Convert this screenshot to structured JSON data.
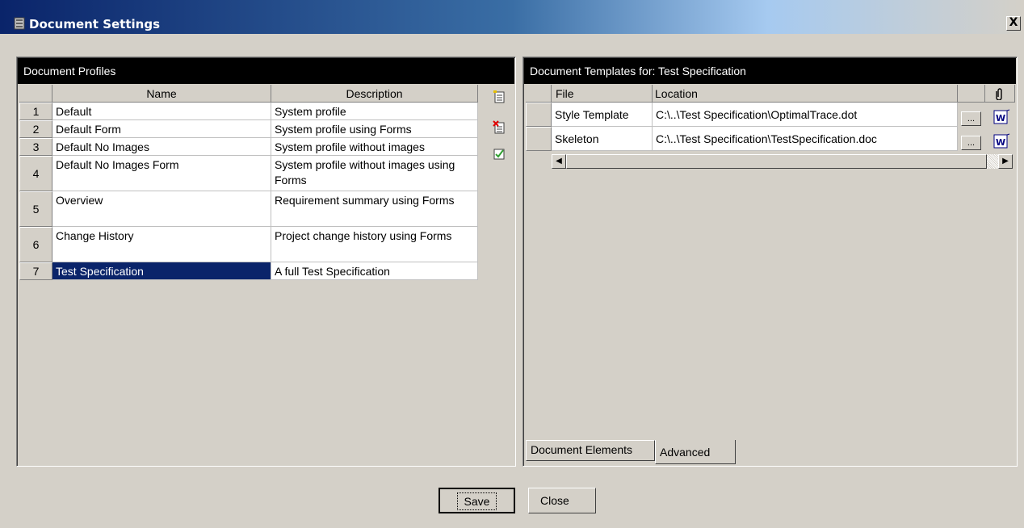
{
  "window": {
    "title": "Document Settings",
    "close_label": "X"
  },
  "profiles": {
    "header": "Document Profiles",
    "columns": [
      "Name",
      "Description"
    ],
    "rows": [
      {
        "num": "1",
        "name": "Default",
        "description": "System profile"
      },
      {
        "num": "2",
        "name": "Default Form",
        "description": "System profile using Forms"
      },
      {
        "num": "3",
        "name": "Default No Images",
        "description": "System profile without images"
      },
      {
        "num": "4",
        "name": "Default No Images Form",
        "description": "System profile without images using Forms"
      },
      {
        "num": "5",
        "name": "Overview",
        "description": "Requirement summary using Forms"
      },
      {
        "num": "6",
        "name": "Change History",
        "description": "Project change history using Forms"
      },
      {
        "num": "7",
        "name": "Test Specification",
        "description": "A full Test Specification"
      }
    ],
    "selected_row": "7"
  },
  "templates": {
    "header": "Document Templates for:  Test Specification",
    "columns": [
      "File",
      "Location"
    ],
    "attach_icon": "paperclip-icon",
    "rows": [
      {
        "file": "Style Template",
        "location": "C:\\..\\Test Specification\\OptimalTrace.dot",
        "browse_label": "...",
        "icon": "word-doc-icon"
      },
      {
        "file": "Skeleton",
        "location": "C:\\..\\Test Specification\\TestSpecification.doc",
        "browse_label": "...",
        "icon": "word-doc-icon"
      }
    ],
    "tabs": [
      {
        "label": "Document Elements",
        "active": false
      },
      {
        "label": "Advanced",
        "active": true
      }
    ]
  },
  "buttons": {
    "save": "Save",
    "close": "Close"
  },
  "colors": {
    "selection": "#0a246a",
    "title_start": "#0a246a",
    "face": "#d4d0c8"
  }
}
